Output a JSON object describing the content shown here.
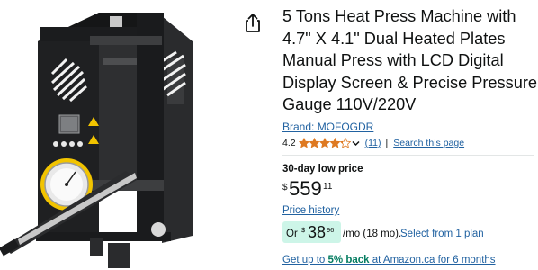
{
  "product": {
    "title": "5 Tons Heat Press Machine with 4.7\" X 4.1\" Dual Heated Plates Manual Press with LCD Digital Display Screen & Precise Pressure Gauge 110V/220V",
    "brand": "Brand: MOFOGDR",
    "image_icon": "heat-press-machine-photo"
  },
  "share": {
    "icon": "share-icon"
  },
  "rating": {
    "value": "4.2",
    "stars": 4.2,
    "count": "(11)",
    "separator": "|",
    "search_link": "Search this page",
    "star_color": "#de7921"
  },
  "pricing": {
    "low_price_label": "30-day low price",
    "currency_symbol": "$",
    "whole": "559",
    "fraction": "11",
    "history_link": "Price history"
  },
  "installment": {
    "prefix": "Or",
    "currency_symbol": "$",
    "whole": "38",
    "fraction": "96",
    "per_month": "/mo (18 mo).",
    "plan_link": "Select from 1 plan",
    "badge_color": "#cdf5e8"
  },
  "cashback": {
    "lead": "Get up to ",
    "percent": "5% back",
    "tail": " at Amazon.ca for 6 months"
  },
  "colors": {
    "link": "#2162a1",
    "text": "#0f1111",
    "green": "#067d62"
  }
}
